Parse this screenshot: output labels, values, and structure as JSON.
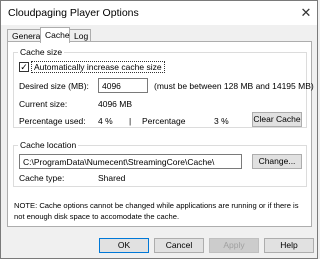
{
  "window": {
    "title": "Cloudpaging Player Options",
    "close_glyph": "✕"
  },
  "tabs": [
    {
      "label": "General"
    },
    {
      "label": "Cache"
    },
    {
      "label": "Log"
    }
  ],
  "cache_size": {
    "group_title": "Cache size",
    "auto_increase_label": "Automatically increase cache size",
    "auto_increase_checked": true,
    "desired_size_label": "Desired size (MB):",
    "desired_size_value": "4096",
    "desired_size_hint": "(must be between 128 MB and 14195 MB)",
    "current_size_label": "Current size:",
    "current_size_value": "4096 MB",
    "percentage_used_label": "Percentage used:",
    "percentage_used_value": "4 %",
    "separator": "|",
    "percentage_label": "Percentage",
    "percentage_value": "3 %",
    "clear_cache_label": "Clear Cache"
  },
  "cache_location": {
    "group_title": "Cache location",
    "path_value": "C:\\ProgramData\\Numecent\\StreamingCore\\Cache\\",
    "change_label": "Change...",
    "type_label": "Cache type:",
    "type_value": "Shared"
  },
  "note": "NOTE: Cache options cannot be changed while applications are running or if there is not enough disk space to accomodate the cache.",
  "footer": {
    "ok_label": "OK",
    "cancel_label": "Cancel",
    "apply_label": "Apply",
    "help_label": "Help"
  }
}
